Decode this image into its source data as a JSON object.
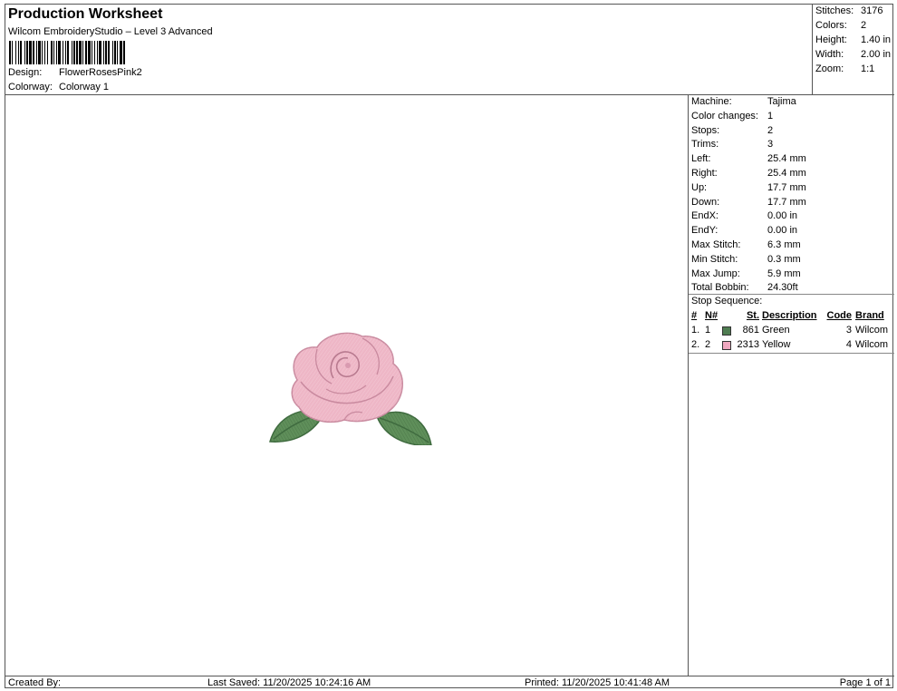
{
  "header": {
    "title": "Production Worksheet",
    "subtitle": "Wilcom EmbroideryStudio – Level 3 Advanced",
    "design_label": "Design:",
    "design_value": "FlowerRosesPink2",
    "colorway_label": "Colorway:",
    "colorway_value": "Colorway 1"
  },
  "stats": {
    "stitches_label": "Stitches:",
    "stitches_value": "3176",
    "colors_label": "Colors:",
    "colors_value": "2",
    "height_label": "Height:",
    "height_value": "1.40 in",
    "width_label": "Width:",
    "width_value": "2.00 in",
    "zoom_label": "Zoom:",
    "zoom_value": "1:1"
  },
  "properties": [
    {
      "label": "Machine:",
      "value": "Tajima"
    },
    {
      "label": "Color changes:",
      "value": "1"
    },
    {
      "label": "Stops:",
      "value": "2"
    },
    {
      "label": "Trims:",
      "value": "3"
    },
    {
      "label": "Left:",
      "value": "25.4 mm"
    },
    {
      "label": "Right:",
      "value": "25.4 mm"
    },
    {
      "label": "Up:",
      "value": "17.7 mm"
    },
    {
      "label": "Down:",
      "value": "17.7 mm"
    },
    {
      "label": "EndX:",
      "value": "0.00 in"
    },
    {
      "label": "EndY:",
      "value": "0.00 in"
    },
    {
      "label": "Max Stitch:",
      "value": "6.3 mm"
    },
    {
      "label": "Min Stitch:",
      "value": "0.3 mm"
    },
    {
      "label": "Max Jump:",
      "value": "5.9 mm"
    },
    {
      "label": "Total Bobbin:",
      "value": "24.30ft"
    }
  ],
  "stop_sequence": {
    "title": "Stop Sequence:",
    "headers": {
      "num": "#",
      "n": "N#",
      "st": "St.",
      "desc": "Description",
      "code": "Code",
      "brand": "Brand"
    },
    "rows": [
      {
        "num": "1.",
        "n": "1",
        "color": "#4f7d52",
        "st": "861",
        "desc": "Green",
        "code": "3",
        "brand": "Wilcom"
      },
      {
        "num": "2.",
        "n": "2",
        "color": "#f0a8c0",
        "st": "2313",
        "desc": "Yellow",
        "code": "4",
        "brand": "Wilcom"
      }
    ]
  },
  "footer": {
    "created": "Created By:",
    "saved": "Last Saved: 11/20/2025 10:24:16 AM",
    "printed": "Printed: 11/20/2025 10:41:48 AM",
    "page": "Page 1 of 1"
  },
  "colors": {
    "rose_pink": "#eeb6c6",
    "rose_shadow": "#c98a9f",
    "leaf_green": "#5f8f5a",
    "leaf_dark": "#3f6b3f"
  }
}
